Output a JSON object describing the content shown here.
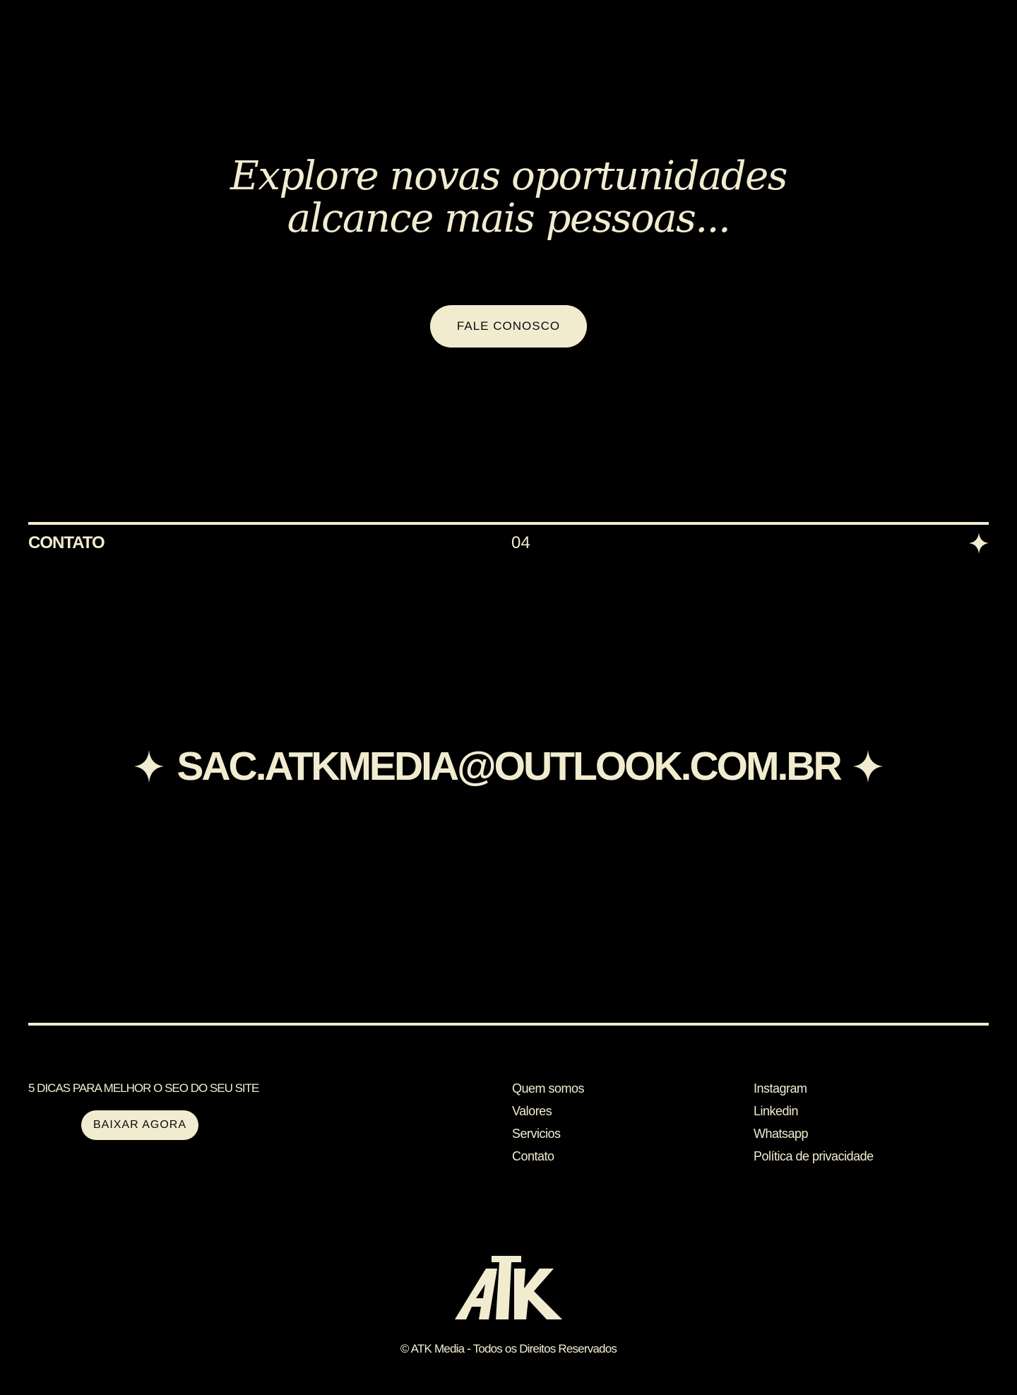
{
  "hero": {
    "title_line1": "Explore novas oportunidades",
    "title_line2": "alcance mais pessoas...",
    "cta_label": "FALE CONOSCO"
  },
  "section": {
    "label": "CONTATO",
    "number": "04",
    "icon": "sparkle-icon"
  },
  "contact": {
    "email": "SAC.ATKMEDIA@OUTLOOK.COM.BR",
    "icon": "sparkle-icon"
  },
  "footer": {
    "promo_text": "5 DICAS PARA MELHOR O SEO DO SEU SITE",
    "promo_button": "BAIXAR AGORA",
    "nav_links": [
      "Quem somos",
      "Valores",
      "Servicios",
      "Contato"
    ],
    "social_links": [
      "Instagram",
      "Linkedin",
      "Whatsapp",
      "Política de privacidade"
    ],
    "logo_text": "ATK",
    "copyright": "© ATK Media - Todos os Direitos Reservados"
  },
  "colors": {
    "background": "#000000",
    "accent": "#f1ecd0",
    "button_text": "#0a0a0a"
  }
}
